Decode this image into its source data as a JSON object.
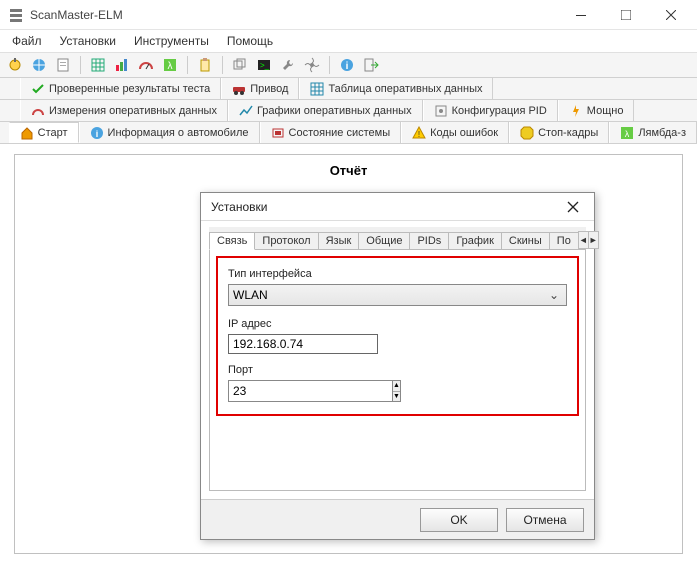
{
  "window": {
    "title": "ScanMaster-ELM"
  },
  "menu": {
    "file": "Файл",
    "settings": "Установки",
    "tools": "Инструменты",
    "help": "Помощь"
  },
  "tabs_row1": {
    "verified": "Проверенные результаты теста",
    "drive": "Привод",
    "op_data_table": "Таблица оперативных данных"
  },
  "tabs_row2": {
    "op_data_meas": "Измерения оперативных данных",
    "op_data_graphs": "Графики оперативных данных",
    "pid_config": "Конфигурация PID",
    "power": "Мощно"
  },
  "tabs_row3": {
    "start": "Старт",
    "vehicle_info": "Информация о автомобиле",
    "system_state": "Состояние системы",
    "error_codes": "Коды ошибок",
    "freeze_frames": "Стоп-кадры",
    "lambda": "Лямбда-з"
  },
  "report": {
    "title": "Отчёт"
  },
  "dialog": {
    "title": "Установки",
    "tabs": {
      "connection": "Связь",
      "protocol": "Протокол",
      "language": "Язык",
      "general": "Общие",
      "pids": "PIDs",
      "graph": "График",
      "skins": "Скины",
      "po": "По"
    },
    "interface_type_label": "Тип интерфейса",
    "interface_type_value": "WLAN",
    "ip_label": "IP адрес",
    "ip_value": "192.168.0.74",
    "port_label": "Порт",
    "port_value": "23",
    "ok": "OK",
    "cancel": "Отмена"
  }
}
